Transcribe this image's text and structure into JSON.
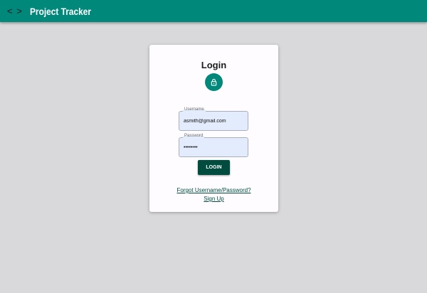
{
  "app": {
    "title": "Project Tracker",
    "icon": "code-icon"
  },
  "login": {
    "heading": "Login",
    "username_label": "Username",
    "username_value": "asmith@gmail.com",
    "password_label": "Password",
    "password_value": "password",
    "button": "LOGIN",
    "forgot": "Forgot Username/Password?",
    "signup": "Sign Up"
  }
}
